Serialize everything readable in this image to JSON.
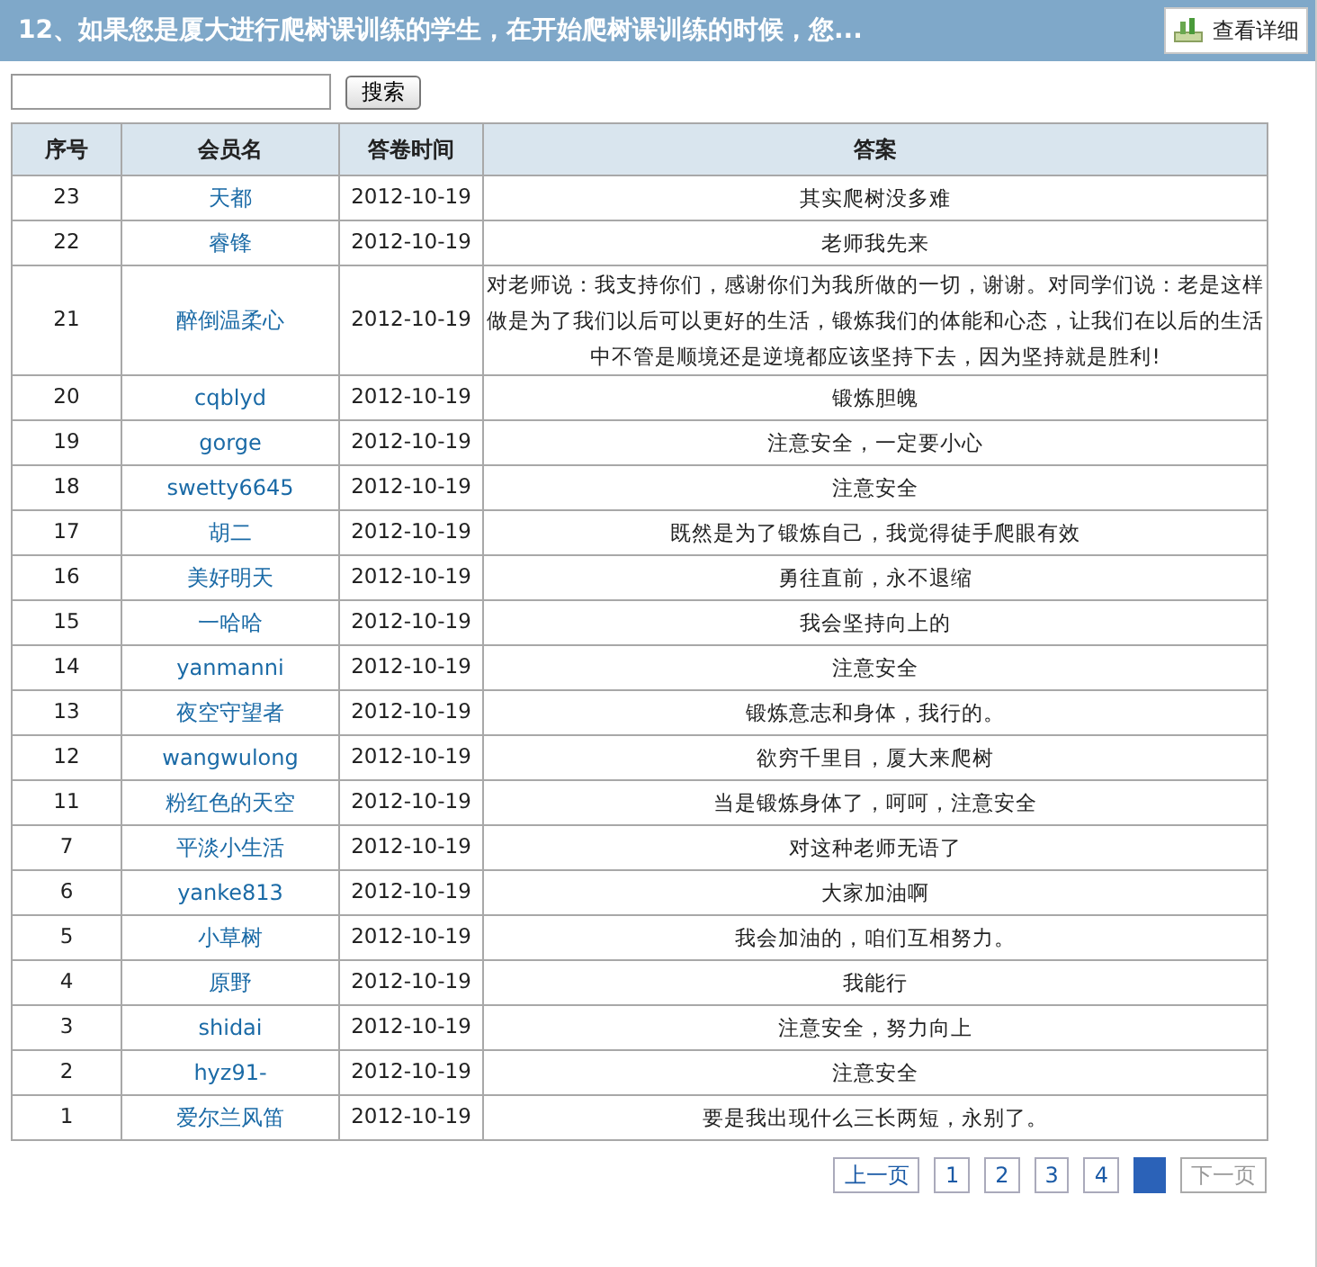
{
  "header": {
    "title": "12、如果您是厦大进行爬树课训练的学生，在开始爬树课训练的时候，您...",
    "detail_button": "查看详细"
  },
  "search": {
    "button": "搜索"
  },
  "table": {
    "columns": [
      "序号",
      "会员名",
      "答卷时间",
      "答案"
    ],
    "rows": [
      {
        "no": "23",
        "member": "天都",
        "time": "2012-10-19",
        "answer": "其实爬树没多难"
      },
      {
        "no": "22",
        "member": "睿锋",
        "time": "2012-10-19",
        "answer": "老师我先来"
      },
      {
        "no": "21",
        "member": "醉倒温柔心",
        "time": "2012-10-19",
        "answer": "对老师说：我支持你们，感谢你们为我所做的一切，谢谢。对同学们说：老是这样做是为了我们以后可以更好的生活，锻炼我们的体能和心态，让我们在以后的生活中不管是顺境还是逆境都应该坚持下去，因为坚持就是胜利!"
      },
      {
        "no": "20",
        "member": "cqblyd",
        "time": "2012-10-19",
        "answer": "锻炼胆魄"
      },
      {
        "no": "19",
        "member": "gorge",
        "time": "2012-10-19",
        "answer": "注意安全，一定要小心"
      },
      {
        "no": "18",
        "member": "swetty6645",
        "time": "2012-10-19",
        "answer": "注意安全"
      },
      {
        "no": "17",
        "member": "胡二",
        "time": "2012-10-19",
        "answer": "既然是为了锻炼自己，我觉得徒手爬眼有效"
      },
      {
        "no": "16",
        "member": "美好明天",
        "time": "2012-10-19",
        "answer": "勇往直前，永不退缩"
      },
      {
        "no": "15",
        "member": "一哈哈",
        "time": "2012-10-19",
        "answer": "我会坚持向上的"
      },
      {
        "no": "14",
        "member": "yanmanni",
        "time": "2012-10-19",
        "answer": "注意安全"
      },
      {
        "no": "13",
        "member": "夜空守望者",
        "time": "2012-10-19",
        "answer": "锻炼意志和身体，我行的。"
      },
      {
        "no": "12",
        "member": "wangwulong",
        "time": "2012-10-19",
        "answer": "欲穷千里目，厦大来爬树"
      },
      {
        "no": "11",
        "member": "粉红色的天空",
        "time": "2012-10-19",
        "answer": "当是锻炼身体了，呵呵，注意安全"
      },
      {
        "no": "7",
        "member": "平淡小生活",
        "time": "2012-10-19",
        "answer": "对这种老师无语了"
      },
      {
        "no": "6",
        "member": "yanke813",
        "time": "2012-10-19",
        "answer": "大家加油啊"
      },
      {
        "no": "5",
        "member": "小草树",
        "time": "2012-10-19",
        "answer": "我会加油的，咱们互相努力。"
      },
      {
        "no": "4",
        "member": "原野",
        "time": "2012-10-19",
        "answer": "我能行"
      },
      {
        "no": "3",
        "member": "shidai",
        "time": "2012-10-19",
        "answer": "注意安全，努力向上"
      },
      {
        "no": "2",
        "member": "hyz91-",
        "time": "2012-10-19",
        "answer": "注意安全"
      },
      {
        "no": "1",
        "member": "爱尔兰风笛",
        "time": "2012-10-19",
        "answer": "要是我出现什么三长两短，永别了。"
      }
    ]
  },
  "pagination": {
    "prev": {
      "label": "上一页",
      "disabled": false
    },
    "pages": [
      {
        "label": "1",
        "selected": false
      },
      {
        "label": "2",
        "selected": false
      },
      {
        "label": "3",
        "selected": false
      },
      {
        "label": "4",
        "selected": false
      },
      {
        "selected": true
      }
    ],
    "next": {
      "label": "下一页",
      "disabled": true
    }
  }
}
